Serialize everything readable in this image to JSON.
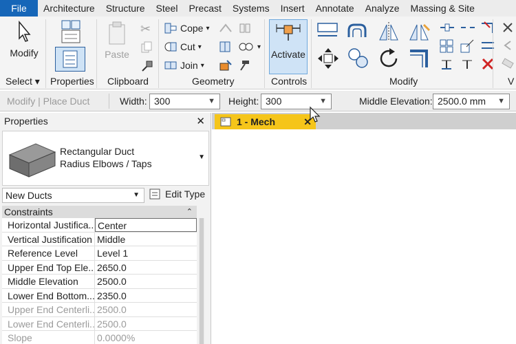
{
  "tabs": [
    "File",
    "Architecture",
    "Structure",
    "Steel",
    "Precast",
    "Systems",
    "Insert",
    "Annotate",
    "Analyze",
    "Massing & Site"
  ],
  "ribbon": {
    "select": {
      "modify_label": "Modify",
      "panel_label": "Select"
    },
    "properties": {
      "panel_label": "Properties"
    },
    "clipboard": {
      "paste_label": "Paste",
      "panel_label": "Clipboard"
    },
    "geometry": {
      "cope_label": "Cope",
      "cut_label": "Cut",
      "join_label": "Join",
      "panel_label": "Geometry"
    },
    "controls": {
      "activate_label": "Activate",
      "panel_label": "Controls"
    },
    "modify": {
      "panel_label": "Modify"
    },
    "right_panel_label": "V"
  },
  "options_bar": {
    "context": "Modify | Place Duct",
    "width_label": "Width:",
    "width_value": "300",
    "height_label": "Height:",
    "height_value": "300",
    "middle_elevation_label": "Middle Elevation:",
    "middle_elevation_value": "2500.0 mm"
  },
  "properties": {
    "title": "Properties",
    "type_line1": "Rectangular Duct",
    "type_line2": "Radius Elbows / Taps",
    "instance_filter": "New Ducts",
    "edit_type_label": "Edit Type",
    "group_label": "Constraints",
    "rows": [
      {
        "key": "Horizontal Justifica...",
        "value": "Center"
      },
      {
        "key": "Vertical Justification",
        "value": "Middle"
      },
      {
        "key": "Reference Level",
        "value": "Level 1"
      },
      {
        "key": "Upper End Top Ele...",
        "value": "2650.0"
      },
      {
        "key": "Middle Elevation",
        "value": "2500.0"
      },
      {
        "key": "Lower End Bottom...",
        "value": "2350.0"
      },
      {
        "key": "Upper End Centerli...",
        "value": "2500.0"
      },
      {
        "key": "Lower End Centerli...",
        "value": "2500.0"
      },
      {
        "key": "Slope",
        "value": "0.0000%"
      }
    ]
  },
  "view": {
    "tab_label": "1 - Mech"
  },
  "colors": {
    "file_tab": "#1666b8",
    "view_tab": "#f5c51a",
    "activate_bg": "#cfe3f6"
  }
}
